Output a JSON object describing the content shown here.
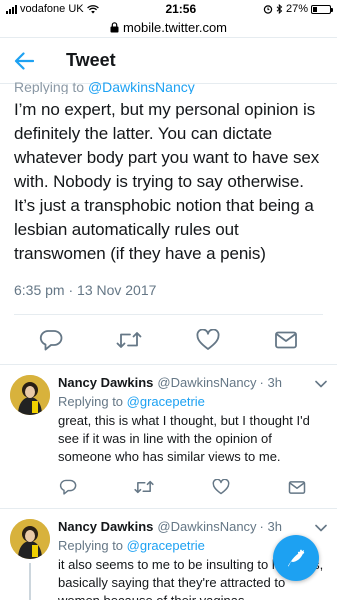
{
  "status_bar": {
    "carrier": "vodafone UK",
    "time": "21:56",
    "battery": "27%",
    "battery_level": 0.27
  },
  "browser": {
    "url": "mobile.twitter.com"
  },
  "header": {
    "title": "Tweet"
  },
  "main_tweet": {
    "replying_prefix": "Replying to ",
    "replying_handle": "@DawkinsNancy",
    "text": "I’m no expert, but my personal opinion is definitely the latter. You can dictate whatever body part you want to have sex with. Nobody is trying to say otherwise. It’s just a transphobic notion that being a lesbian automatically rules out transwomen (if they have a penis)",
    "timestamp": "6:35 pm · 13 Nov 2017"
  },
  "replies": [
    {
      "name": "Nancy Dawkins",
      "handle": "@DawkinsNancy",
      "time": "· 3h",
      "replying_prefix": "Replying to ",
      "replying_handle": "@gracepetrie",
      "text": "great, this is what I thought, but I thought I'd see if it was in line with the opinion of someone who has similar views to me."
    },
    {
      "name": "Nancy Dawkins",
      "handle": "@DawkinsNancy",
      "time": "· 3h",
      "replying_prefix": "Replying to ",
      "replying_handle": "@gracepetrie",
      "text": "it also seems to me to be insulting to lesbians, basically saying that they're attracted to women because of their vaginas."
    }
  ],
  "colors": {
    "accent": "#1da1f2",
    "secondary_text": "#657786"
  }
}
